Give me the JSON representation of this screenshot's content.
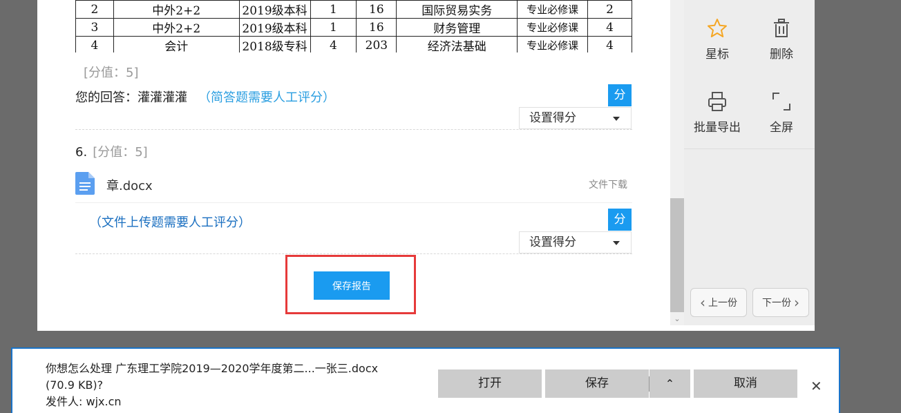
{
  "table": {
    "rows": [
      [
        "2",
        "中外2+2",
        "2019级本科",
        "1",
        "16",
        "国际贸易实务",
        "专业必修课",
        "2"
      ],
      [
        "3",
        "中外2+2",
        "2019级本科",
        "1",
        "16",
        "财务管理",
        "专业必修课",
        "4"
      ],
      [
        "4",
        "会计",
        "2018级专科",
        "4",
        "203",
        "经济法基础",
        "专业必修课",
        "4"
      ]
    ]
  },
  "q5": {
    "score_label": "[分值：5]",
    "answer_prefix": "您的回答：灌灌灌灌",
    "answer_hint": "（简答题需要人工评分）",
    "score_button": "分",
    "set_score": "设置得分"
  },
  "q6": {
    "number": "6.",
    "score_label": "[分值：5]",
    "file_name": "章.docx",
    "download_label": "文件下载",
    "hint": "（文件上传题需要人工评分）",
    "score_button": "分",
    "set_score": "设置得分"
  },
  "save_button": "保存报告",
  "toolbar": {
    "star": "星标",
    "delete": "删除",
    "export": "批量导出",
    "fullscreen": "全屏",
    "prev": "上一份",
    "next": "下一份"
  },
  "download_bar": {
    "line1": "你想怎么处理 广东理工学院2019—2020学年度第二...一张三.docx",
    "line2": "(70.9 KB)?",
    "line3": "发件人: wjx.cn",
    "open": "打开",
    "save": "保存",
    "cancel": "取消"
  },
  "colors": {
    "accent": "#1a9bf0",
    "highlight": "#e63a3a",
    "star": "#f5a623"
  }
}
